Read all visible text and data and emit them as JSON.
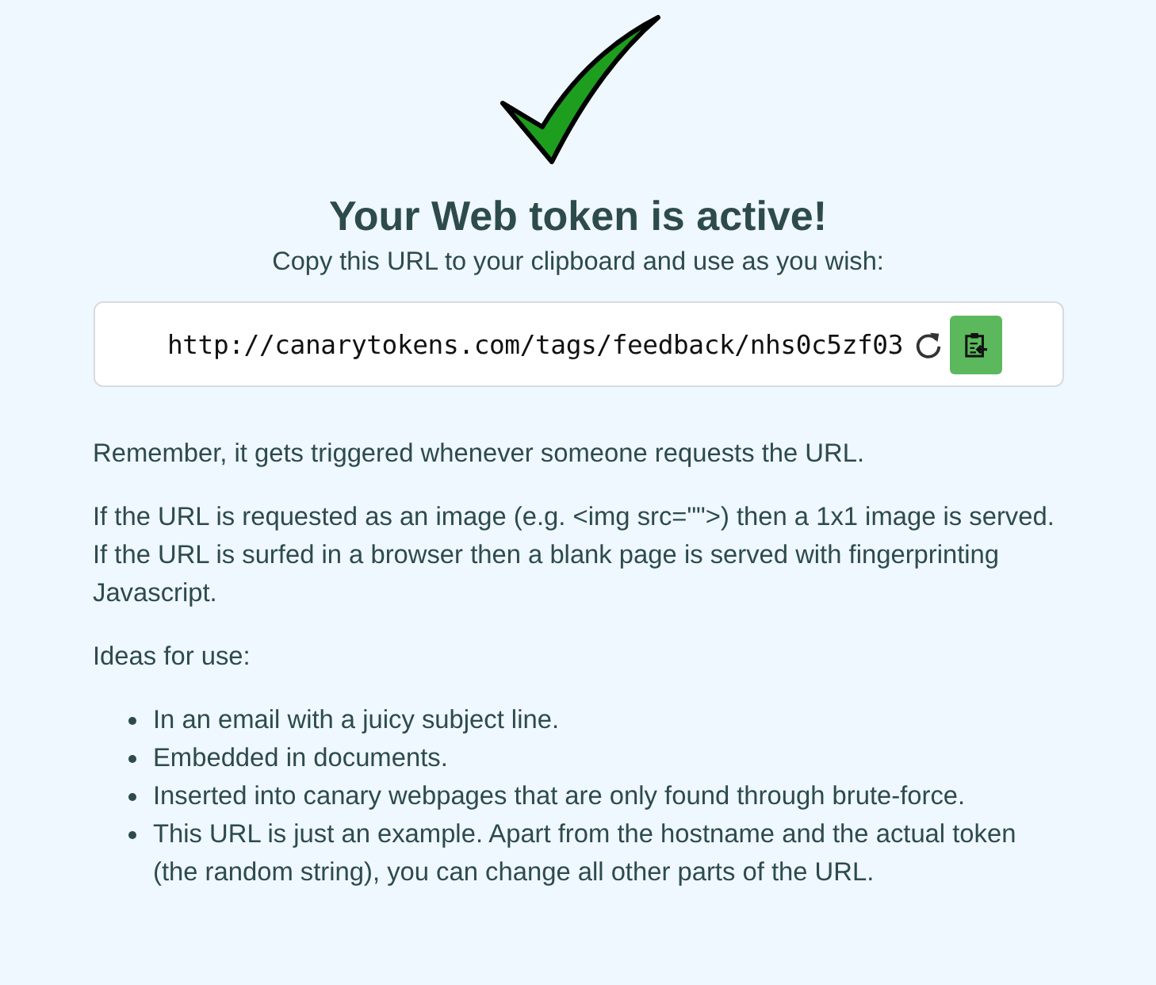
{
  "heading": "Your Web token is active!",
  "subheading": "Copy this URL to your clipboard and use as you wish:",
  "token_field": {
    "value": "http://canarytokens.com/tags/feedback/nhs0c5zf03"
  },
  "paragraphs": [
    {
      "lines": [
        "Remember, it gets triggered whenever someone requests the URL."
      ]
    },
    {
      "lines": [
        "If the URL is requested as an image (e.g. <img src=\"\">) then a 1x1 image is served.",
        "If the URL is surfed in a browser then a blank page is served with fingerprinting Javascript."
      ]
    },
    {
      "lines": [
        "Ideas for use:"
      ]
    }
  ],
  "ideas": [
    "In an email with a juicy subject line.",
    "Embedded in documents.",
    "Inserted into canary webpages that are only found through brute-force.",
    "This URL is just an example. Apart from the hostname and the actual token (the random string), you can change all other parts of the URL."
  ]
}
